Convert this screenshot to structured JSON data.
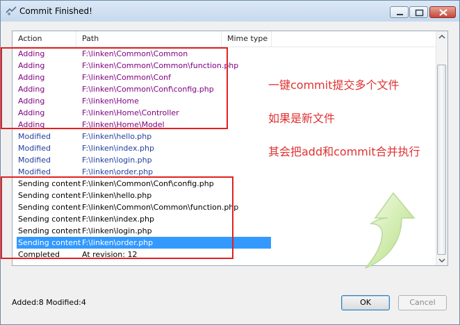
{
  "window": {
    "title": "Commit Finished!"
  },
  "columns": {
    "action": "Action",
    "path": "Path",
    "mime": "Mime type"
  },
  "rows": [
    {
      "action": "Adding",
      "path": "F:\\linken\\Common\\Common",
      "kind": "adding"
    },
    {
      "action": "Adding",
      "path": "F:\\linken\\Common\\Common\\function.php",
      "kind": "adding"
    },
    {
      "action": "Adding",
      "path": "F:\\linken\\Common\\Conf",
      "kind": "adding"
    },
    {
      "action": "Adding",
      "path": "F:\\linken\\Common\\Conf\\config.php",
      "kind": "adding"
    },
    {
      "action": "Adding",
      "path": "F:\\linken\\Home",
      "kind": "adding"
    },
    {
      "action": "Adding",
      "path": "F:\\linken\\Home\\Controller",
      "kind": "adding"
    },
    {
      "action": "Adding",
      "path": "F:\\linken\\Home\\Model",
      "kind": "adding"
    },
    {
      "action": "Modified",
      "path": "F:\\linken\\hello.php",
      "kind": "modified"
    },
    {
      "action": "Modified",
      "path": "F:\\linken\\index.php",
      "kind": "modified"
    },
    {
      "action": "Modified",
      "path": "F:\\linken\\login.php",
      "kind": "modified"
    },
    {
      "action": "Modified",
      "path": "F:\\linken\\order.php",
      "kind": "modified"
    },
    {
      "action": "Sending content",
      "path": "F:\\linken\\Common\\Conf\\config.php",
      "kind": "sending"
    },
    {
      "action": "Sending content",
      "path": "F:\\linken\\hello.php",
      "kind": "sending"
    },
    {
      "action": "Sending content",
      "path": "F:\\linken\\Common\\Common\\function.php",
      "kind": "sending"
    },
    {
      "action": "Sending content",
      "path": "F:\\linken\\index.php",
      "kind": "sending"
    },
    {
      "action": "Sending content",
      "path": "F:\\linken\\login.php",
      "kind": "sending"
    },
    {
      "action": "Sending content",
      "path": "F:\\linken\\order.php",
      "kind": "sending",
      "selected": true
    },
    {
      "action": "Completed",
      "path": "At revision: 12",
      "kind": "completed"
    }
  ],
  "annotations": {
    "line1": "一键commit提交多个文件",
    "line2": "如果是新文件",
    "line3": "其会把add和commit合并执行"
  },
  "footer": {
    "summary": "Added:8 Modified:4",
    "ok_label": "OK",
    "cancel_label": "Cancel"
  },
  "colors": {
    "adding": "#800080",
    "modified": "#1f3f9f",
    "selection": "#3399ff",
    "annotation": "#e03030"
  }
}
